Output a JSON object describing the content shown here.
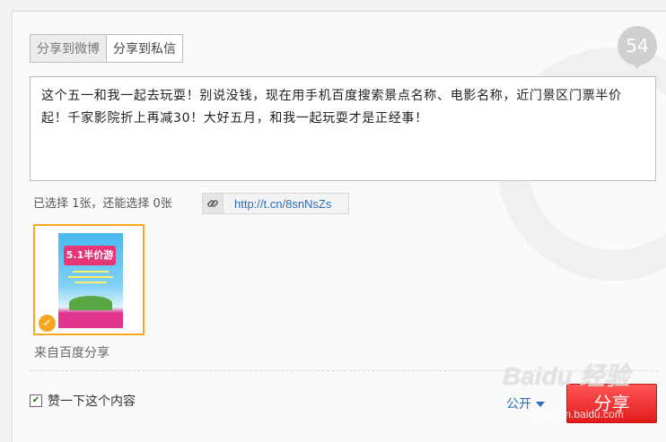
{
  "tabs": [
    {
      "label": "分享到微博",
      "active": true
    },
    {
      "label": "分享到私信",
      "active": false
    }
  ],
  "counter": "54",
  "composer": {
    "text": "这个五一和我一起去玩耍！别说没钱，现在用手机百度搜索景点名称、电影名称，近门景区门票半价起！千家影院折上再减30！大好五月，和我一起玩耍才是正经事！"
  },
  "selection_info": "已选择 1张，还能选择 0张",
  "link": {
    "url": "http://t.cn/8snNsZs",
    "icon": "link-icon"
  },
  "attachment": {
    "poster_title": "5.1半价游",
    "selected": true,
    "icon": "check-icon"
  },
  "source": "来自百度分享",
  "like": {
    "label": "赞一下这个内容",
    "checked": true
  },
  "visibility": "公开",
  "share_button": "分享",
  "watermark": {
    "text": "Baidu 经验",
    "sub": "jingyan.baidu.com"
  },
  "colors": {
    "accent_orange": "#f5a623",
    "link_blue": "#2b6db2",
    "share_red": "#e83a3a"
  }
}
